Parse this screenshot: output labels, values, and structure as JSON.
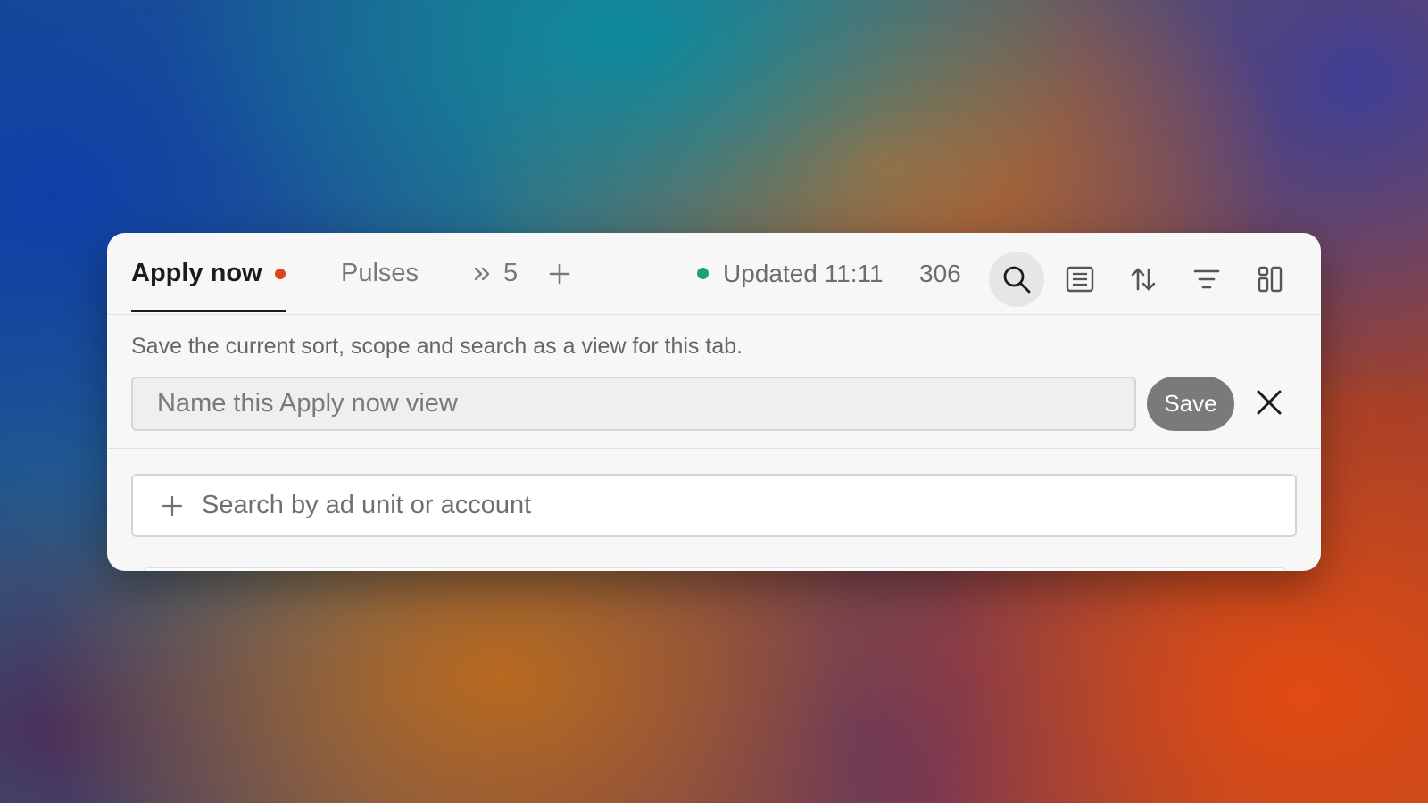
{
  "tabs": [
    {
      "label": "Apply now",
      "active": true,
      "unsaved_dot_color": "#e0421b"
    },
    {
      "label": "Pulses",
      "active": false
    }
  ],
  "overflow_tab": {
    "icon": "double-chevron-right-icon",
    "count": "5"
  },
  "add_tab_icon": "plus-icon",
  "status": {
    "text": "Updated 11:11",
    "dot_color": "#1aa36b"
  },
  "count": "306",
  "toolbar_icons": [
    "search-icon",
    "list-icon",
    "sort-icon",
    "filter-icon",
    "columns-icon"
  ],
  "save_view": {
    "hint": "Save the current sort, scope and search as a view for this tab.",
    "name_placeholder": "Name this Apply now view",
    "save_label": "Save",
    "close_icon": "close-icon"
  },
  "search": {
    "icon": "plus-icon",
    "placeholder": "Search by ad unit or account"
  },
  "colors": {
    "panel_bg": "#f7f7f7",
    "save_button_bg": "#7a7a7a",
    "active_text": "#1c1c1c"
  }
}
